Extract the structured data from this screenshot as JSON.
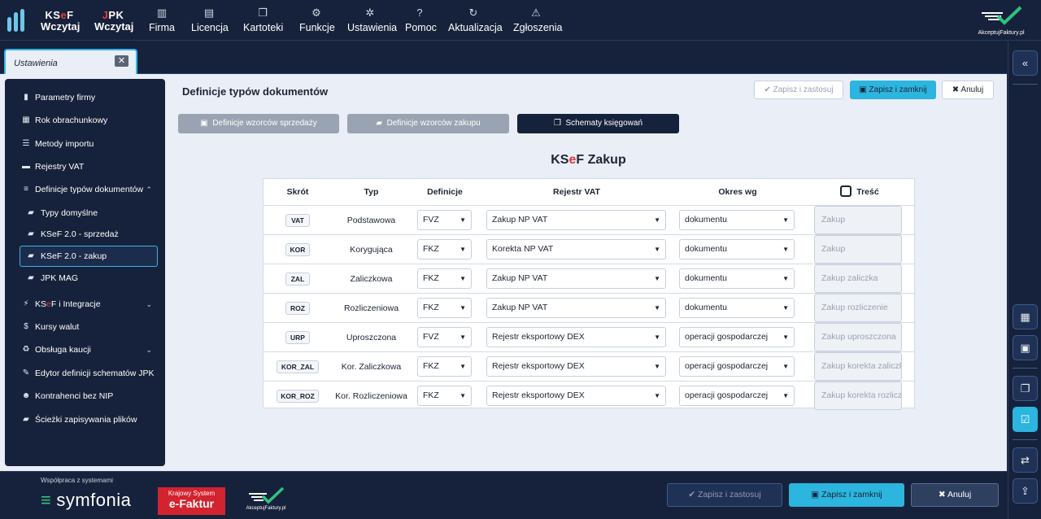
{
  "topbar": {
    "ksef_l1": "KS",
    "ksef_e": "e",
    "ksef_f": "F",
    "ksef_l2": "Wczytaj",
    "jpk_j": "J",
    "jpk_rest": "PK",
    "jpk_l2": "Wczytaj",
    "nav": [
      {
        "label": "Firma",
        "icon": "building-icon"
      },
      {
        "label": "Licencja",
        "icon": "license-icon"
      },
      {
        "label": "Kartoteki",
        "icon": "folders-icon"
      },
      {
        "label": "Funkcje",
        "icon": "functions-icon"
      },
      {
        "label": "Ustawienia",
        "icon": "gear-icon"
      },
      {
        "label": "Pomoc",
        "icon": "help-icon"
      },
      {
        "label": "Aktualizacja",
        "icon": "refresh-icon"
      },
      {
        "label": "Zgłoszenia",
        "icon": "warning-icon"
      }
    ],
    "brand": "AkceptujFaktury.pl"
  },
  "tab": {
    "label": "Ustawienia",
    "close": "✕"
  },
  "sidebar": {
    "items": [
      {
        "label": "Parametry firmy",
        "icon": "document-icon"
      },
      {
        "label": "Rok obrachunkowy",
        "icon": "calendar-icon"
      },
      {
        "label": "Metody importu",
        "icon": "sliders-icon"
      },
      {
        "label": "Rejestry VAT",
        "icon": "register-icon"
      },
      {
        "label": "Definicje typów dokumentów",
        "icon": "list-icon",
        "chevron": "⌃"
      },
      {
        "label": "Typy domyślne",
        "icon": "folder-icon"
      },
      {
        "label": "KSeF 2.0 - sprzedaż",
        "icon": "folder-icon"
      },
      {
        "label": "KSeF 2.0 - zakup",
        "icon": "folder-icon"
      },
      {
        "label": "JPK MAG",
        "icon": "folder-icon"
      },
      {
        "label_pre": "KS",
        "label_e": "e",
        "label_post": "F i Integracje",
        "icon": "plug-icon",
        "chevron": "⌄"
      },
      {
        "label": "Kursy walut",
        "icon": "dollar-icon"
      },
      {
        "label": "Obsługa kaucji",
        "icon": "recycle-icon",
        "chevron": "⌄"
      },
      {
        "label": "Edytor definicji schematów JPK",
        "icon": "edit-icon"
      },
      {
        "label": "Kontrahenci bez NIP",
        "icon": "users-icon"
      },
      {
        "label": "Ścieżki zapisywania plików",
        "icon": "folder-open-icon"
      }
    ]
  },
  "main": {
    "title": "Definicje typów dokumentów",
    "btn_apply": "Zapisz i zastosuj",
    "btn_save_close": "Zapisz i zamknij",
    "btn_cancel": "Anuluj",
    "sub_sales": "Definicje wzorców sprzedaży",
    "sub_purchase": "Definicje wzorców zakupu",
    "sub_schemas": "Schematy księgowań",
    "section_pre": "KS",
    "section_e": "e",
    "section_post": "F Zakup",
    "headers": [
      "Skrót",
      "Typ",
      "Definicje",
      "Rejestr VAT",
      "Okres wg",
      "Treść"
    ],
    "rows": [
      {
        "code": "VAT",
        "typ": "Podstawowa",
        "def": "FVZ",
        "rejestr": "Zakup NP VAT",
        "okres": "dokumentu",
        "tresc": "Zakup"
      },
      {
        "code": "KOR",
        "typ": "Korygująca",
        "def": "FKZ",
        "rejestr": "Korekta NP VAT",
        "okres": "dokumentu",
        "tresc": "Zakup"
      },
      {
        "code": "ZAL",
        "typ": "Zaliczkowa",
        "def": "FKZ",
        "rejestr": "Zakup NP VAT",
        "okres": "dokumentu",
        "tresc": "Zakup zaliczka"
      },
      {
        "code": "ROZ",
        "typ": "Rozliczeniowa",
        "def": "FKZ",
        "rejestr": "Zakup NP VAT",
        "okres": "dokumentu",
        "tresc": "Zakup rozliczenie"
      },
      {
        "code": "URP",
        "typ": "Uproszczona",
        "def": "FVZ",
        "rejestr": "Rejestr eksportowy DEX",
        "okres": "operacji gospodarczej",
        "tresc": "Zakup uproszczona"
      },
      {
        "code": "KOR_ZAL",
        "typ": "Kor. Zaliczkowa",
        "def": "FKZ",
        "rejestr": "Rejestr eksportowy DEX",
        "okres": "operacji gospodarczej",
        "tresc": "Zakup korekta zaliczki"
      },
      {
        "code": "KOR_ROZ",
        "typ": "Kor. Rozliczeniowa",
        "def": "FKZ",
        "rejestr": "Rejestr eksportowy DEX",
        "okres": "operacji gospodarczej",
        "tresc": "Zakup korekta rozliczenia"
      }
    ]
  },
  "bottom": {
    "coop": "Współpraca z systemami",
    "symfonia": "symfonia",
    "ksef_badge_l1": "Krajowy System",
    "ksef_badge_l2": "e-Faktur",
    "brand": "AkceptujFaktury.pl",
    "btn_apply": "Zapisz i zastosuj",
    "btn_save_close": "Zapisz i zamknij",
    "btn_cancel": "Anuluj"
  },
  "colors": {
    "accent": "#2bb5df",
    "navy": "#16223b",
    "ksef_red": "#e5393b"
  }
}
